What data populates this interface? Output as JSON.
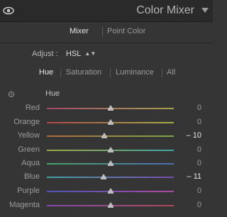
{
  "panel": {
    "title": "Color Mixer"
  },
  "tabs": {
    "mixer": "Mixer",
    "point_color": "Point Color"
  },
  "adjust": {
    "label": "Adjust :",
    "value": "HSL",
    "arrows": "▲▼"
  },
  "subtabs": {
    "hue": "Hue",
    "saturation": "Saturation",
    "luminance": "Luminance",
    "all": "All"
  },
  "section": {
    "label": "Hue"
  },
  "sliders": [
    {
      "label": "Red",
      "value": "0",
      "level": 0,
      "gradient": [
        "#a5476b",
        "#a9a34d"
      ]
    },
    {
      "label": "Orange",
      "value": "0",
      "level": 0,
      "gradient": [
        "#b04848",
        "#a6ad46"
      ]
    },
    {
      "label": "Yellow",
      "value": "– 10",
      "level": -10,
      "gradient": [
        "#b06a3c",
        "#7ea84a"
      ]
    },
    {
      "label": "Green",
      "value": "0",
      "level": 0,
      "gradient": [
        "#a0a844",
        "#3fa5a6"
      ]
    },
    {
      "label": "Aqua",
      "value": "0",
      "level": 0,
      "gradient": [
        "#46a36a",
        "#4a6cb0"
      ]
    },
    {
      "label": "Blue",
      "value": "– 11",
      "level": -11,
      "gradient": [
        "#43a3a5",
        "#7a4ab0"
      ]
    },
    {
      "label": "Purple",
      "value": "0",
      "level": 0,
      "gradient": [
        "#4a55b3",
        "#b046a6"
      ]
    },
    {
      "label": "Magenta",
      "value": "0",
      "level": 0,
      "gradient": [
        "#8448b0",
        "#b04a58"
      ]
    }
  ]
}
